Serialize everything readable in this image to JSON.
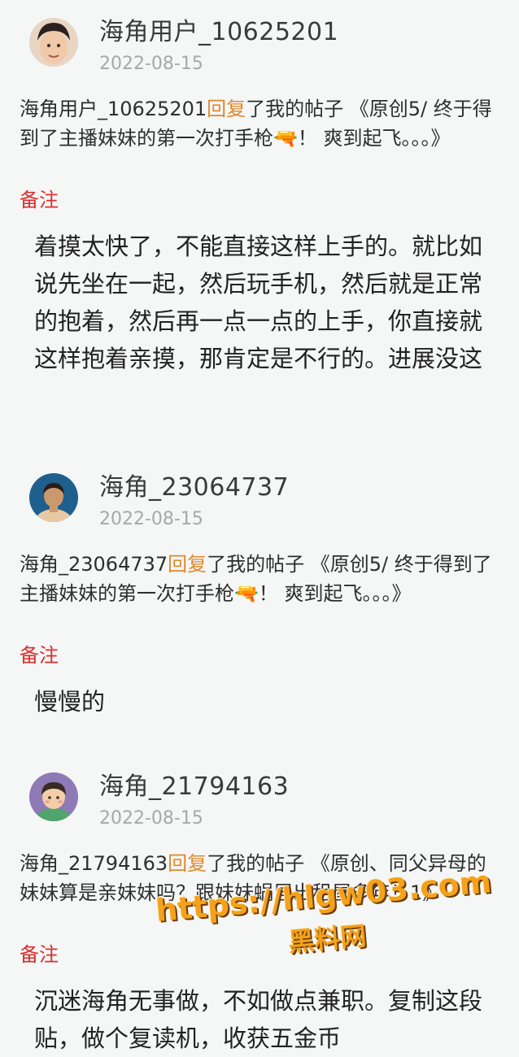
{
  "posts": [
    {
      "username": "海角用户_10625201",
      "date": "2022-08-15",
      "notice_user": "海角用户_10625201",
      "reply_word": "回复",
      "notice_rest": "了我的帖子 《原创5/ 终于得到了主播妹妹的第一次打手枪🔫！ 爽到起飞。。。》",
      "remark": "备注",
      "content": "着摸太快了，不能直接这样上手的。就比如说先坐在一起，然后玩手机，然后就是正常的抱着，然后再一点一点的上手，你直接就这样抱着亲摸，那肯定是不行的。进展没这"
    },
    {
      "username": "海角_23064737",
      "date": "2022-08-15",
      "notice_user": "海角_23064737",
      "reply_word": "回复",
      "notice_rest": "了我的帖子 《原创5/ 终于得到了主播妹妹的第一次打手枪🔫！ 爽到起飞。。。》",
      "remark": "备注",
      "content": "慢慢的"
    },
    {
      "username": "海角_21794163",
      "date": "2022-08-15",
      "notice_user": "海角_21794163",
      "reply_word": "回复",
      "notice_rest": "了我的帖子 《原创、同父异母的妹妹算是亲妹妹吗？跟妹妹蜗居出租屋多年！1》",
      "remark": "备注",
      "content": "沉迷海角无事做，不如做点兼职。复制这段贴，做个复读机，收获五金币"
    }
  ],
  "watermark": {
    "url": "https://hlgw03.com",
    "label": "黑料网"
  },
  "colors": {
    "reply_accent": "#e0892d",
    "remark_red": "#d9302c",
    "date_gray": "#a8a8a8",
    "watermark_orange": "#f4a11b"
  }
}
